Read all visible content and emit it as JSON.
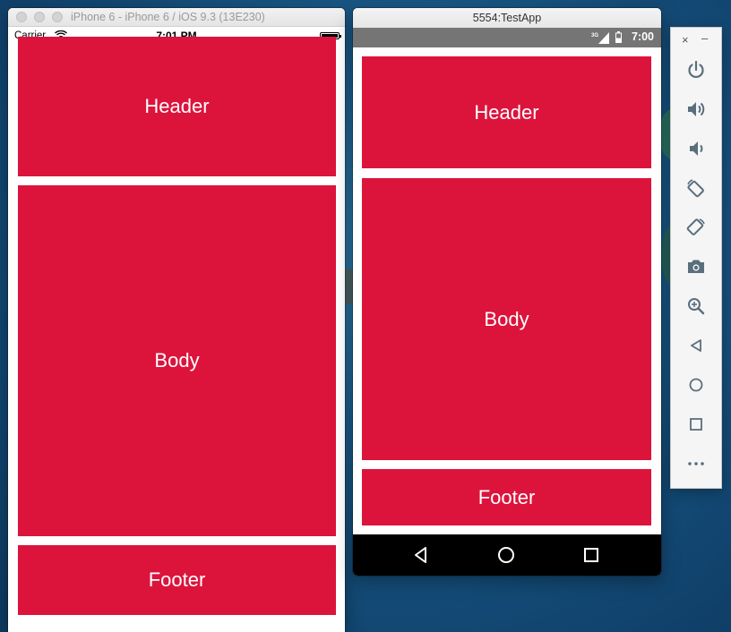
{
  "ios": {
    "window_title": "iPhone 6 - iPhone 6 / iOS 9.3 (13E230)",
    "carrier": "Carrier",
    "time": "7:01 PM",
    "header": "Header",
    "body": "Body",
    "footer": "Footer"
  },
  "android": {
    "window_title": "5554:TestApp",
    "network": "3G",
    "time": "7:00",
    "header": "Header",
    "body": "Body",
    "footer": "Footer"
  },
  "colors": {
    "block_red": "#dc143c",
    "android_statusbar": "#757575",
    "android_navbar": "#000000"
  },
  "toolbar": {
    "close": "×",
    "minimize": "–",
    "icons": [
      "power-icon",
      "volume-up-icon",
      "volume-down-icon",
      "rotate-left-icon",
      "rotate-right-icon",
      "camera-icon",
      "zoom-icon",
      "back-icon",
      "home-icon",
      "overview-icon",
      "more-icon"
    ]
  }
}
